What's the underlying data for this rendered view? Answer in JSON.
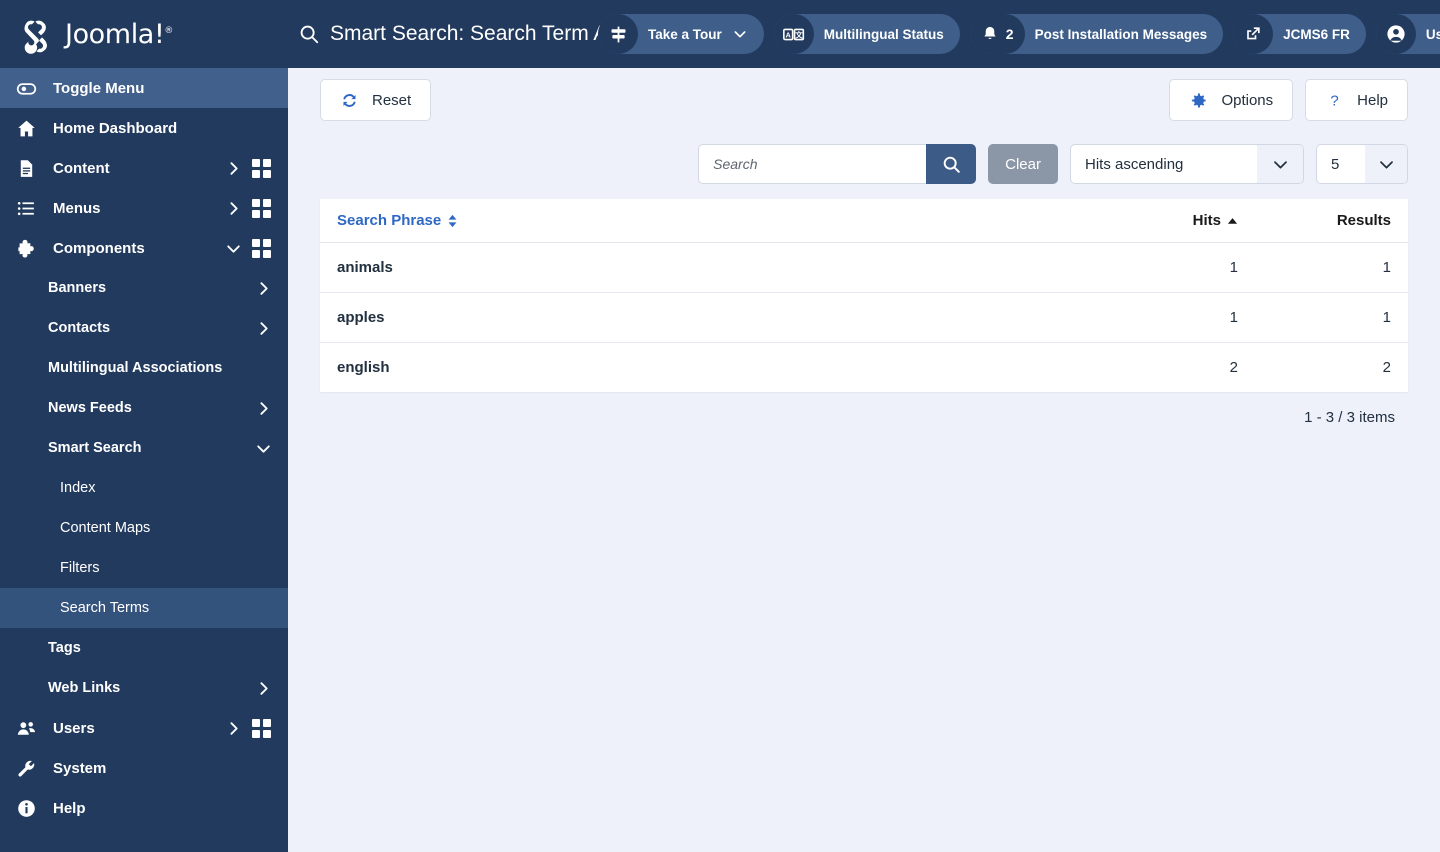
{
  "brand": {
    "name": "Joomla!",
    "trademark": "®",
    "logo_icon": "joomla-logo-icon"
  },
  "sidebar": {
    "toggle": {
      "label": "Toggle Menu",
      "icon": "toggle-switch-icon"
    },
    "items": [
      {
        "label": "Home Dashboard",
        "icon": "home-icon",
        "level": 0,
        "chevron": "none",
        "grid": false
      },
      {
        "label": "Content",
        "icon": "document-icon",
        "level": 0,
        "chevron": "right",
        "grid": true
      },
      {
        "label": "Menus",
        "icon": "list-icon",
        "level": 0,
        "chevron": "right",
        "grid": true
      },
      {
        "label": "Components",
        "icon": "puzzle-icon",
        "level": 0,
        "chevron": "down",
        "grid": true
      },
      {
        "label": "Banners",
        "icon": "",
        "level": 1,
        "chevron": "right",
        "grid": false
      },
      {
        "label": "Contacts",
        "icon": "",
        "level": 1,
        "chevron": "right",
        "grid": false
      },
      {
        "label": "Multilingual Associations",
        "icon": "",
        "level": 1,
        "chevron": "none",
        "grid": false
      },
      {
        "label": "News Feeds",
        "icon": "",
        "level": 1,
        "chevron": "right",
        "grid": false
      },
      {
        "label": "Smart Search",
        "icon": "",
        "level": 1,
        "chevron": "down",
        "grid": false
      },
      {
        "label": "Index",
        "icon": "",
        "level": 2,
        "chevron": "none",
        "grid": false
      },
      {
        "label": "Content Maps",
        "icon": "",
        "level": 2,
        "chevron": "none",
        "grid": false
      },
      {
        "label": "Filters",
        "icon": "",
        "level": 2,
        "chevron": "none",
        "grid": false
      },
      {
        "label": "Search Terms",
        "icon": "",
        "level": 2,
        "chevron": "none",
        "grid": false,
        "active": true
      },
      {
        "label": "Tags",
        "icon": "",
        "level": 1,
        "chevron": "none",
        "grid": false
      },
      {
        "label": "Web Links",
        "icon": "",
        "level": 1,
        "chevron": "right",
        "grid": false
      },
      {
        "label": "Users",
        "icon": "users-icon",
        "level": 0,
        "chevron": "right",
        "grid": true
      },
      {
        "label": "System",
        "icon": "wrench-icon",
        "level": 0,
        "chevron": "none",
        "grid": false
      },
      {
        "label": "Help",
        "icon": "info-icon",
        "level": 0,
        "chevron": "none",
        "grid": false
      }
    ]
  },
  "header": {
    "title": "Smart Search: Search Term Ana",
    "title_icon": "magnifier-icon",
    "pills": [
      {
        "label": "Take a Tour",
        "icon": "signpost-icon",
        "chevron": true
      },
      {
        "label": "Multilingual Status",
        "icon": "language-icon",
        "chevron": false
      },
      {
        "label": "Post Installation Messages",
        "icon": "bell-icon",
        "badge": "2",
        "chevron": false
      },
      {
        "label": "JCMS6 FR",
        "icon": "external-link-icon",
        "chevron": false
      },
      {
        "label": "User Menu",
        "icon": "user-circle-icon",
        "chevron": true
      }
    ],
    "overflow_icon": "ellipsis-icon"
  },
  "toolbar": {
    "reset_label": "Reset",
    "reset_icon": "refresh-icon",
    "options_label": "Options",
    "options_icon": "gear-icon",
    "help_label": "Help",
    "help_icon": "question-mark-icon"
  },
  "filters": {
    "search_placeholder": "Search",
    "search_value": "",
    "search_icon": "search-icon",
    "clear_label": "Clear",
    "ordering_value": "Hits ascending",
    "limit_value": "5",
    "chevron_icon": "chevron-down-icon"
  },
  "table": {
    "columns": [
      {
        "key": "phrase",
        "label": "Search Phrase",
        "sort": "both",
        "link": true
      },
      {
        "key": "hits",
        "label": "Hits",
        "sort": "asc",
        "link": false
      },
      {
        "key": "results",
        "label": "Results",
        "sort": "none",
        "link": false
      }
    ],
    "rows": [
      {
        "phrase": "animals",
        "hits": "1",
        "results": "1"
      },
      {
        "phrase": "apples",
        "hits": "1",
        "results": "1"
      },
      {
        "phrase": "english",
        "hits": "2",
        "results": "2"
      }
    ],
    "pagination": "1 - 3 / 3 items"
  },
  "colors": {
    "sidebar_bg": "#223a5e",
    "sidebar_active": "#33527c",
    "toggle_bg": "#41608c",
    "accent_blue": "#2f68c4",
    "search_btn": "#3c5c87",
    "clear_btn": "#8b96a6",
    "page_bg": "#eef1fa",
    "pill_bg": "#3f5f8a"
  }
}
